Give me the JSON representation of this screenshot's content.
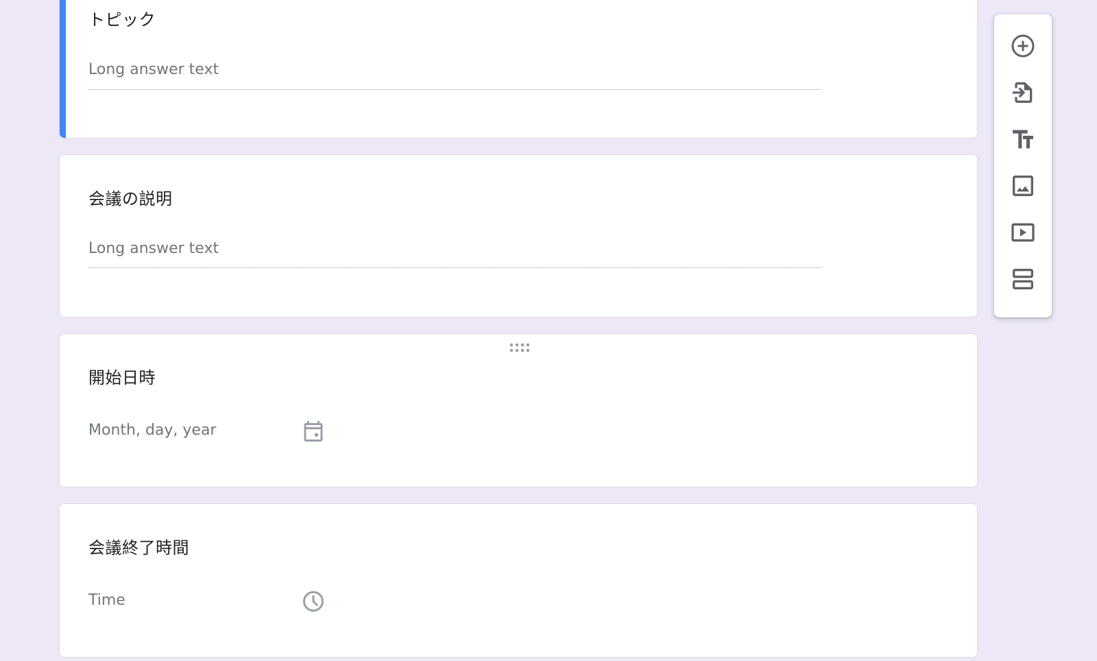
{
  "questions": [
    {
      "title": "トピック",
      "placeholder": "Long answer text",
      "type": "paragraph"
    },
    {
      "title": "会議の説明",
      "placeholder": "Long answer text",
      "type": "paragraph"
    },
    {
      "title": "開始日時",
      "placeholder": "Month, day, year",
      "type": "date"
    },
    {
      "title": "会議終了時間",
      "placeholder": "Time",
      "type": "time"
    }
  ],
  "sidebar": {
    "tools": [
      {
        "icon": "add-circle-icon",
        "label": "Add question"
      },
      {
        "icon": "import-questions-icon",
        "label": "Import questions"
      },
      {
        "icon": "title-text-icon",
        "label": "Add title and description"
      },
      {
        "icon": "image-icon",
        "label": "Add image"
      },
      {
        "icon": "video-icon",
        "label": "Add video"
      },
      {
        "icon": "section-icon",
        "label": "Add section"
      }
    ]
  },
  "colors": {
    "background": "#ede7f6",
    "active_accent": "#4285f4",
    "icon": "#5f6368",
    "placeholder_text": "#70757a"
  }
}
